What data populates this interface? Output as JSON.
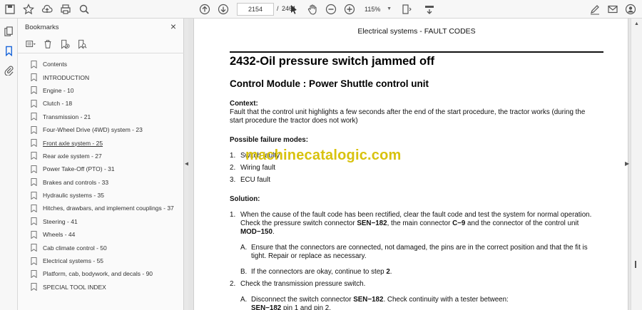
{
  "toolbar": {
    "page_current": "2154",
    "page_separator": "/",
    "page_total": "2461",
    "zoom": "115%"
  },
  "bookmarks": {
    "title": "Bookmarks",
    "close_glyph": "×",
    "items": [
      {
        "label": "Contents"
      },
      {
        "label": "INTRODUCTION"
      },
      {
        "label": "Engine - 10"
      },
      {
        "label": "Clutch - 18"
      },
      {
        "label": "Transmission - 21"
      },
      {
        "label": "Four-Wheel Drive (4WD) system - 23"
      },
      {
        "label": "Front axle system - 25"
      },
      {
        "label": "Rear axle system - 27"
      },
      {
        "label": "Power Take-Off (PTO) - 31"
      },
      {
        "label": "Brakes and controls - 33"
      },
      {
        "label": "Hydraulic systems - 35"
      },
      {
        "label": "Hitches, drawbars, and implement couplings - 37"
      },
      {
        "label": "Steering - 41"
      },
      {
        "label": "Wheels - 44"
      },
      {
        "label": "Cab climate control - 50"
      },
      {
        "label": "Electrical systems - 55"
      },
      {
        "label": "Platform, cab, bodywork, and decals - 90"
      },
      {
        "label": "SPECIAL TOOL INDEX"
      }
    ]
  },
  "document": {
    "header": "Electrical systems - FAULT CODES",
    "title": "2432-Oil pressure switch jammed off",
    "control_module": "Control Module :  Power Shuttle control unit",
    "context_heading": "Context:",
    "context_line1": "Fault that the control unit highlights a few seconds after the end of the start procedure, the tractor works (during the",
    "context_line2": "start procedure the tractor does not work)",
    "failure_heading": "Possible failure modes:",
    "failure_modes": [
      {
        "num": "1.",
        "text": "Switch faulty"
      },
      {
        "num": "2.",
        "text": "Wiring fault"
      },
      {
        "num": "3.",
        "text": "ECU fault"
      }
    ],
    "solution_heading": "Solution:",
    "step1_num": "1.",
    "step1_line1": "When the cause of the fault code has been rectified, clear the fault code and test the system for normal operation.",
    "step1_line2a": "Check the pressure switch connector ",
    "step1_line2b": "SEN−182",
    "step1_line2c": ", the main connector ",
    "step1_line2d": "C−9",
    "step1_line2e": " and the connector of the control unit",
    "step1_line3": "MOD−150",
    "step1_line3b": ".",
    "stepA_label": "A.",
    "stepA_line1": "Ensure that the connectors are connected, not damaged, the pins are in the correct position and that the fit is",
    "stepA_line2": "tight.  Repair or replace as necessary.",
    "stepB_label": "B.",
    "stepB_text": "If the connectors are okay, continue to step ",
    "stepB_num": "2",
    "stepB_end": ".",
    "step2_num": "2.",
    "step2_text": "Check the transmission pressure switch.",
    "step2A_label": "A.",
    "step2A_text_a": "Disconnect the switch connector ",
    "step2A_text_b": "SEN−182",
    "step2A_text_c": ".  Check continuity with a tester between:",
    "step2A_line2_a": "SEN−182",
    "step2A_line2_b": " pin 1 and pin 2."
  },
  "watermark": "machinecatalogic.com",
  "colors": {
    "watermark": "#d8c20e",
    "toolbar_bg": "#f7f7f7"
  }
}
